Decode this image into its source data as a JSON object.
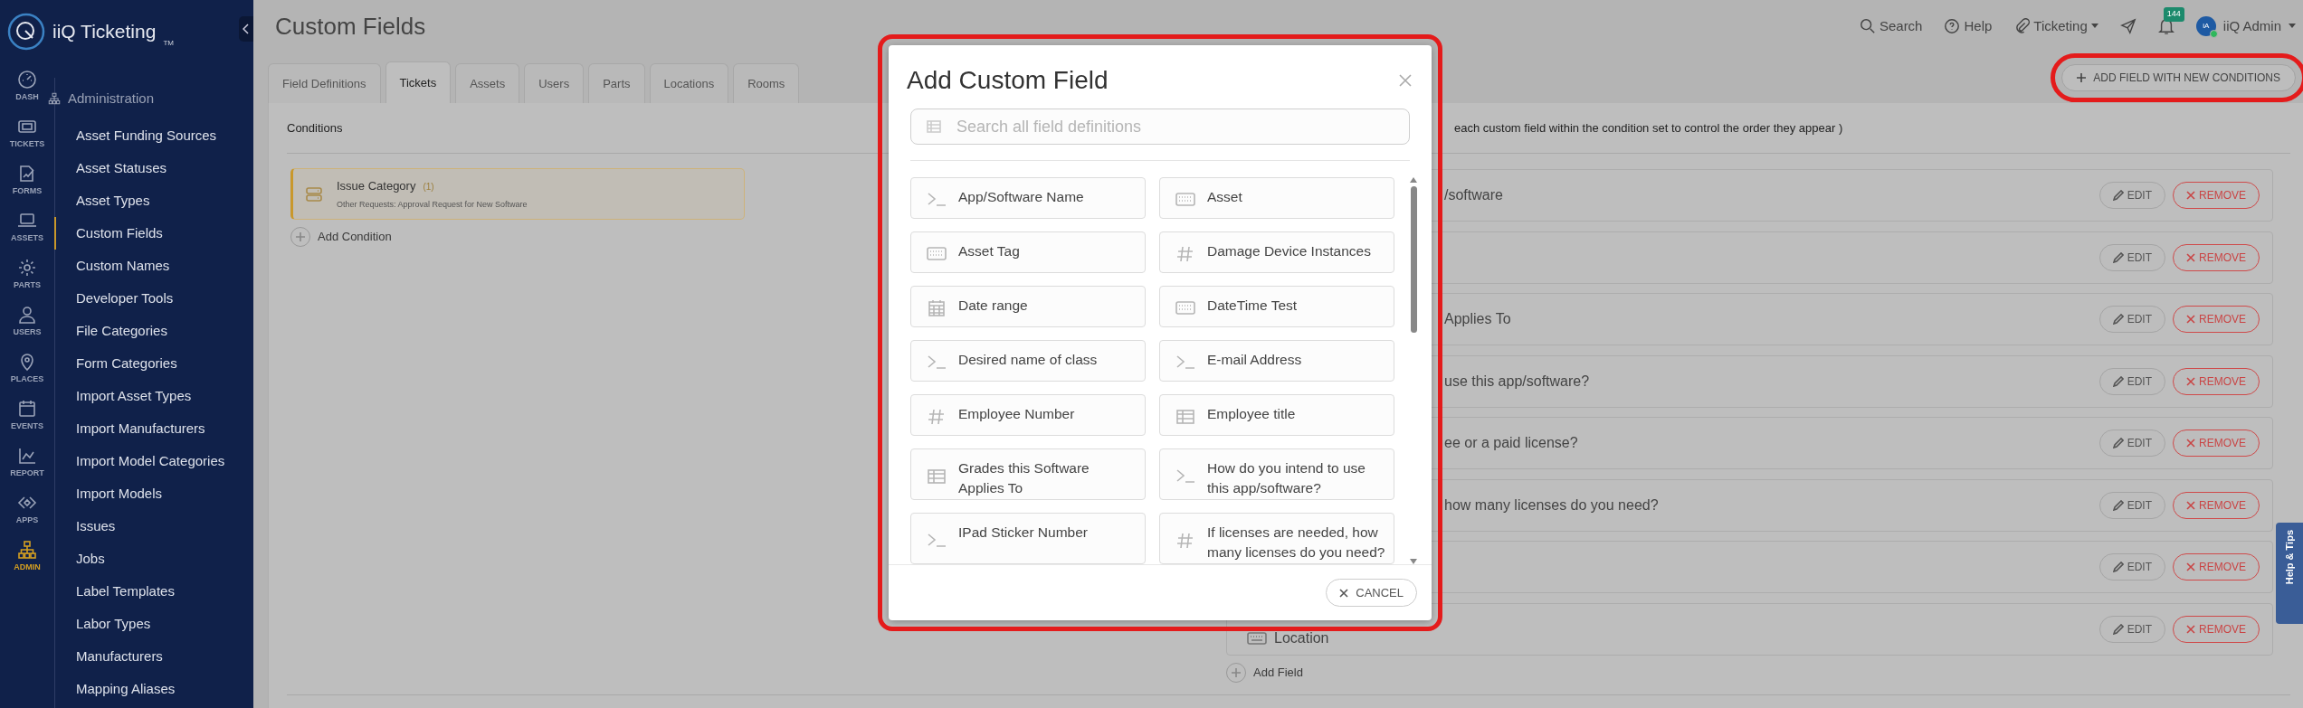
{
  "app": {
    "name": "iiQ Ticketing",
    "trademark": "TM"
  },
  "rail": [
    {
      "label": "DASH",
      "selected": false
    },
    {
      "label": "TICKETS",
      "selected": false
    },
    {
      "label": "FORMS",
      "selected": false
    },
    {
      "label": "ASSETS",
      "selected": false
    },
    {
      "label": "PARTS",
      "selected": false
    },
    {
      "label": "USERS",
      "selected": false
    },
    {
      "label": "PLACES",
      "selected": false
    },
    {
      "label": "EVENTS",
      "selected": false
    },
    {
      "label": "REPORT",
      "selected": false
    },
    {
      "label": "APPS",
      "selected": false
    },
    {
      "label": "ADMIN",
      "selected": true
    }
  ],
  "sidebar": {
    "section": "Administration",
    "items": [
      {
        "label": "Asset Funding Sources",
        "selected": false
      },
      {
        "label": "Asset Statuses",
        "selected": false
      },
      {
        "label": "Asset Types",
        "selected": false
      },
      {
        "label": "Custom Fields",
        "selected": true
      },
      {
        "label": "Custom Names",
        "selected": false
      },
      {
        "label": "Developer Tools",
        "selected": false
      },
      {
        "label": "File Categories",
        "selected": false
      },
      {
        "label": "Form Categories",
        "selected": false
      },
      {
        "label": "Import Asset Types",
        "selected": false
      },
      {
        "label": "Import Manufacturers",
        "selected": false
      },
      {
        "label": "Import Model Categories",
        "selected": false
      },
      {
        "label": "Import Models",
        "selected": false
      },
      {
        "label": "Issues",
        "selected": false
      },
      {
        "label": "Jobs",
        "selected": false
      },
      {
        "label": "Label Templates",
        "selected": false
      },
      {
        "label": "Labor Types",
        "selected": false
      },
      {
        "label": "Manufacturers",
        "selected": false
      },
      {
        "label": "Mapping Aliases",
        "selected": false
      }
    ]
  },
  "page_title": "Custom Fields",
  "toolbar": {
    "search": "Search",
    "help": "Help",
    "product": "Ticketing",
    "notifications": "144",
    "avatar": "iA",
    "user": "iiQ Admin"
  },
  "tabs": [
    {
      "label": "Field Definitions",
      "selected": false
    },
    {
      "label": "Tickets",
      "selected": true
    },
    {
      "label": "Assets",
      "selected": false
    },
    {
      "label": "Users",
      "selected": false
    },
    {
      "label": "Parts",
      "selected": false
    },
    {
      "label": "Locations",
      "selected": false
    },
    {
      "label": "Rooms",
      "selected": false
    }
  ],
  "add_button": {
    "label": "ADD FIELD WITH NEW CONDITIONS",
    "highlighted": true
  },
  "conditions": {
    "heading": "Conditions",
    "items": [
      {
        "title": "Issue Category",
        "count": "(1)",
        "detail": "Other Requests: Approval Request for New Software"
      }
    ],
    "add_label": "Add Condition"
  },
  "fields_panel": {
    "note": "each custom field within the condition set to control the order they appear )",
    "rows": [
      {
        "kind": "clipped",
        "label": "/software",
        "edit": "EDIT",
        "remove": "REMOVE"
      },
      {
        "kind": "clipped",
        "edit": "EDIT",
        "remove": "REMOVE"
      },
      {
        "kind": "clipped",
        "label": "Applies To",
        "edit": "EDIT",
        "remove": "REMOVE"
      },
      {
        "kind": "clipped",
        "label": "use this app/software?",
        "edit": "EDIT",
        "remove": "REMOVE"
      },
      {
        "kind": "clipped",
        "label": "ee or a paid license?",
        "edit": "EDIT",
        "remove": "REMOVE"
      },
      {
        "kind": "clipped",
        "label": "how many licenses do you need?",
        "edit": "EDIT",
        "remove": "REMOVE"
      },
      {
        "kind": "clipped",
        "edit": "EDIT",
        "remove": "REMOVE"
      },
      {
        "kind": "field",
        "label": "Location",
        "edit": "EDIT",
        "remove": "REMOVE"
      }
    ],
    "add_label": "Add Field"
  },
  "help_tab": "Help & Tips",
  "modal": {
    "title": "Add Custom Field",
    "search_placeholder": "Search all field definitions",
    "highlighted": true,
    "items": [
      {
        "label": "App/Software Name",
        "kind": "text"
      },
      {
        "label": "Asset",
        "kind": "keyboard"
      },
      {
        "label": "Asset Tag",
        "kind": "keyboard"
      },
      {
        "label": "Damage Device Instances",
        "kind": "number"
      },
      {
        "label": "Date range",
        "kind": "date"
      },
      {
        "label": "DateTime Test",
        "kind": "keyboard"
      },
      {
        "label": "Desired name of class",
        "kind": "text"
      },
      {
        "label": "E-mail Address",
        "kind": "text"
      },
      {
        "label": "Employee Number",
        "kind": "number"
      },
      {
        "label": "Employee title",
        "kind": "grid"
      },
      {
        "label": "Grades this Software Applies To",
        "kind": "grid"
      },
      {
        "label": "How do you intend to use this app/software?",
        "kind": "text"
      },
      {
        "label": "IPad Sticker Number",
        "kind": "text"
      },
      {
        "label": "If licenses are needed, how many licenses do you need?",
        "kind": "number"
      }
    ],
    "cancel": "CANCEL"
  }
}
